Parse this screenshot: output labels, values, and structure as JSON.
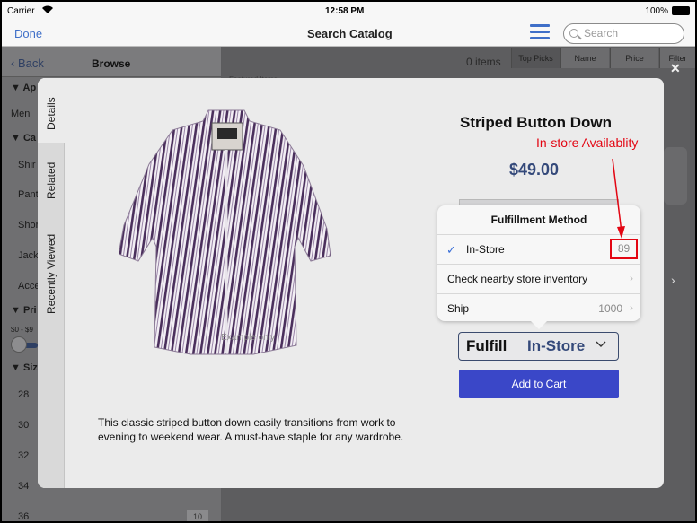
{
  "status_bar": {
    "carrier": "Carrier",
    "time": "12:58 PM",
    "battery": "100%"
  },
  "navbar": {
    "done_label": "Done",
    "title": "Search Catalog",
    "search_placeholder": "Search"
  },
  "sidebar": {
    "back_label": "Back",
    "title": "Browse",
    "rows": [
      {
        "text": "▼ Ap",
        "kind": "head"
      },
      {
        "text": "Men",
        "kind": "item"
      },
      {
        "text": "▼ Ca",
        "kind": "head"
      },
      {
        "text": "Shir",
        "kind": "item"
      },
      {
        "text": "Pant",
        "kind": "item"
      },
      {
        "text": "Shor",
        "kind": "item"
      },
      {
        "text": "Jack",
        "kind": "item"
      },
      {
        "text": "Acce",
        "kind": "item"
      },
      {
        "text": "▼ Pri",
        "kind": "head"
      },
      {
        "text": "$0 - $9",
        "kind": "small"
      },
      {
        "text": "▼ Siz",
        "kind": "head"
      },
      {
        "text": "28",
        "kind": "item"
      },
      {
        "text": "30",
        "kind": "item"
      },
      {
        "text": "32",
        "kind": "item"
      },
      {
        "text": "34",
        "kind": "item"
      },
      {
        "text": "36",
        "kind": "item"
      }
    ],
    "badge_36": "10"
  },
  "main_bg": {
    "items_count": "0 items",
    "sort_tabs": [
      "Top Picks",
      "Name",
      "Price",
      "Filter"
    ],
    "featured_label": "Featured Items"
  },
  "modal": {
    "close_glyph": "✕",
    "tabs": [
      "Details",
      "Related",
      "Recently Viewed"
    ],
    "image_watermark": "Example only",
    "description": "This classic striped button down easily transitions from work to evening to weekend wear.  A must-have staple for any wardrobe.",
    "product_name": "Striped Button Down",
    "price": "$49.00",
    "annotation": "In-store Availablity",
    "fulfill_label": "Fulfill",
    "fulfill_value": "In-Store",
    "add_to_cart": "Add to Cart"
  },
  "popover": {
    "title": "Fulfillment Method",
    "options": [
      {
        "label": "In-Store",
        "value": "89",
        "checked": true
      },
      {
        "label": "Check nearby store inventory",
        "value": ""
      },
      {
        "label": "Ship",
        "value": "1000"
      }
    ]
  },
  "colors": {
    "accent_blue": "#3a47c8",
    "price_navy": "#34497a",
    "annotation_red": "#e30613",
    "check_blue": "#3a6fd8"
  },
  "icons": {
    "menu": "hamburger-icon",
    "search": "search-icon",
    "back": "chevron-left-icon",
    "check": "checkmark-icon",
    "chevron_right": "chevron-right-icon",
    "chevron_down": "chevron-down-icon",
    "close": "close-icon"
  }
}
